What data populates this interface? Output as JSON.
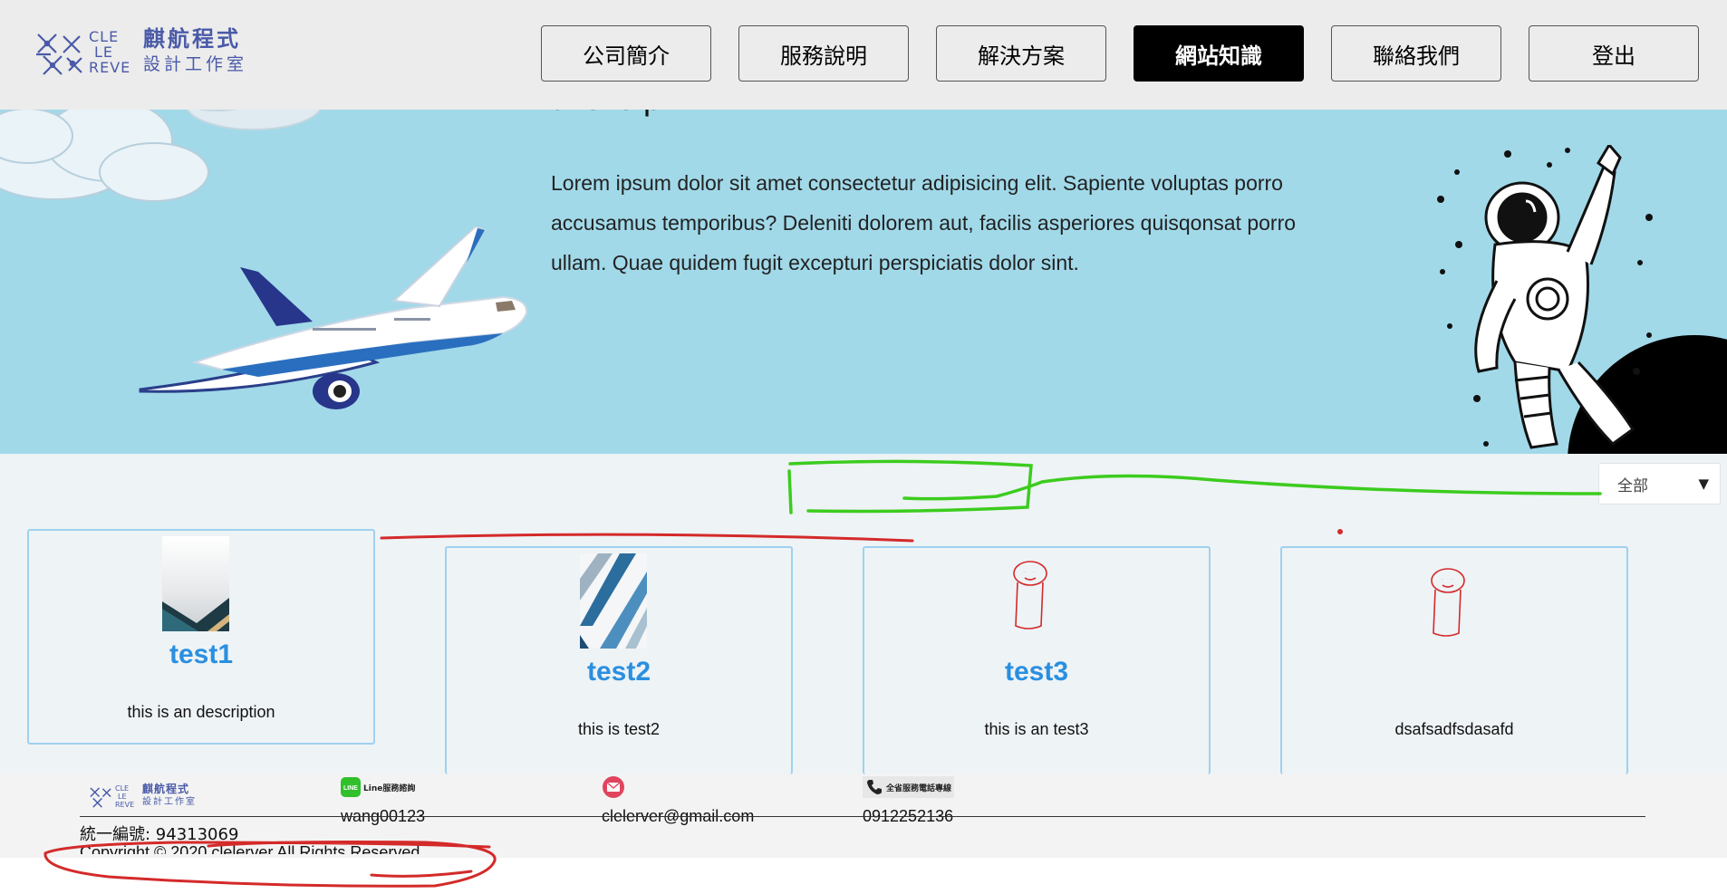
{
  "brand": {
    "letters": [
      "CLE",
      "LE",
      "REVE"
    ],
    "zh_line1": "麒航程式",
    "zh_line2": "設計工作室",
    "colors": {
      "logo": "#4a5aa8"
    }
  },
  "nav": {
    "items": [
      {
        "label": "公司簡介",
        "active": false
      },
      {
        "label": "服務說明",
        "active": false
      },
      {
        "label": "解決方案",
        "active": false
      },
      {
        "label": "網站知識",
        "active": true
      },
      {
        "label": "聯絡我們",
        "active": false
      },
      {
        "label": "登出",
        "active": false
      }
    ]
  },
  "hero": {
    "title": "this is prv",
    "description": "Lorem ipsum dolor sit amet consectetur adipisicing elit. Sapiente voluptas porro accusamus temporibus? Deleniti dolorem aut, facilis asperiores quisqonsat porro ullam. Quae quidem fugit excepturi perspiciatis dolor sint.",
    "background": "#a1d9e9",
    "illustrations": [
      "cloud-icon",
      "airplane-icon",
      "astronaut-icon"
    ]
  },
  "filter": {
    "selected": "全部",
    "caret": "▼"
  },
  "cards": [
    {
      "title": "test1",
      "description": "this is an description",
      "image": "dark-abstract-thumbnail"
    },
    {
      "title": "test2",
      "description": "this is test2",
      "image": "blue-stripes-thumbnail"
    },
    {
      "title": "test3",
      "description": "this is an test3",
      "image": "doodle-sketch-thumbnail"
    },
    {
      "title": "",
      "description": "dsafsadfsdasafd",
      "image": "doodle-sketch-thumbnail"
    }
  ],
  "footer": {
    "line_badge": "Line服務諮詢",
    "line_id": "wang00123",
    "email": "clelerver@gmail.com",
    "phone_badge": "全省服務電話專線",
    "phone": "0912252136",
    "tax_id": "統一編號: 94313069",
    "copyright": "Copyright © 2020 clelerver All Rights Reserved"
  },
  "annotations": {
    "green": "#3ccc1e",
    "red": "#d42a2a"
  }
}
